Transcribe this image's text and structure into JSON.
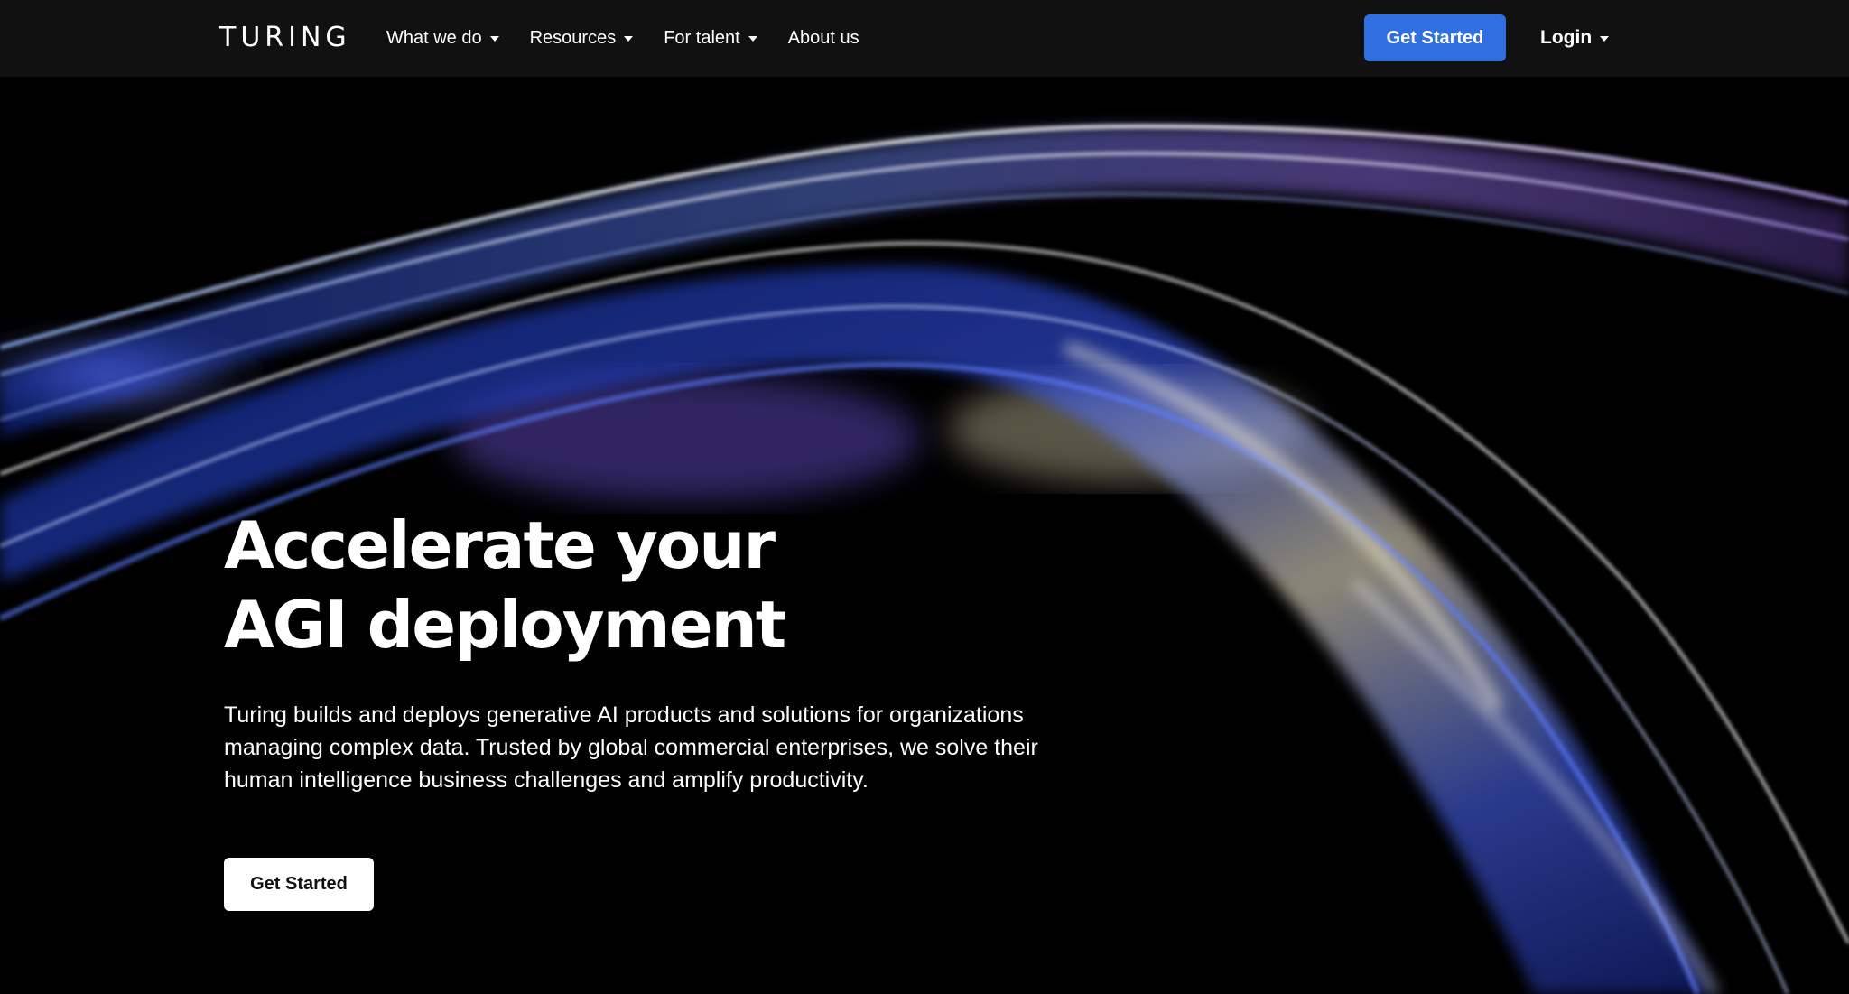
{
  "nav": {
    "logo": "TURING",
    "menu": [
      {
        "label": "What we do",
        "has_dropdown": true
      },
      {
        "label": "Resources",
        "has_dropdown": true
      },
      {
        "label": "For talent",
        "has_dropdown": true
      },
      {
        "label": "About us",
        "has_dropdown": false
      }
    ],
    "cta_label": "Get Started",
    "login_label": "Login"
  },
  "hero": {
    "title_line1": "Accelerate your",
    "title_line2": "AGI deployment",
    "description_line1": "Turing builds and deploys generative AI products and solutions for organizations",
    "description_line2": "managing complex data. Trusted by global commercial enterprises, we solve their",
    "description_line3": "human intelligence business challenges and amplify productivity.",
    "cta_label": "Get Started"
  },
  "colors": {
    "nav_background": "#111111",
    "primary_button": "#2f6fe0",
    "page_background": "#000000"
  }
}
